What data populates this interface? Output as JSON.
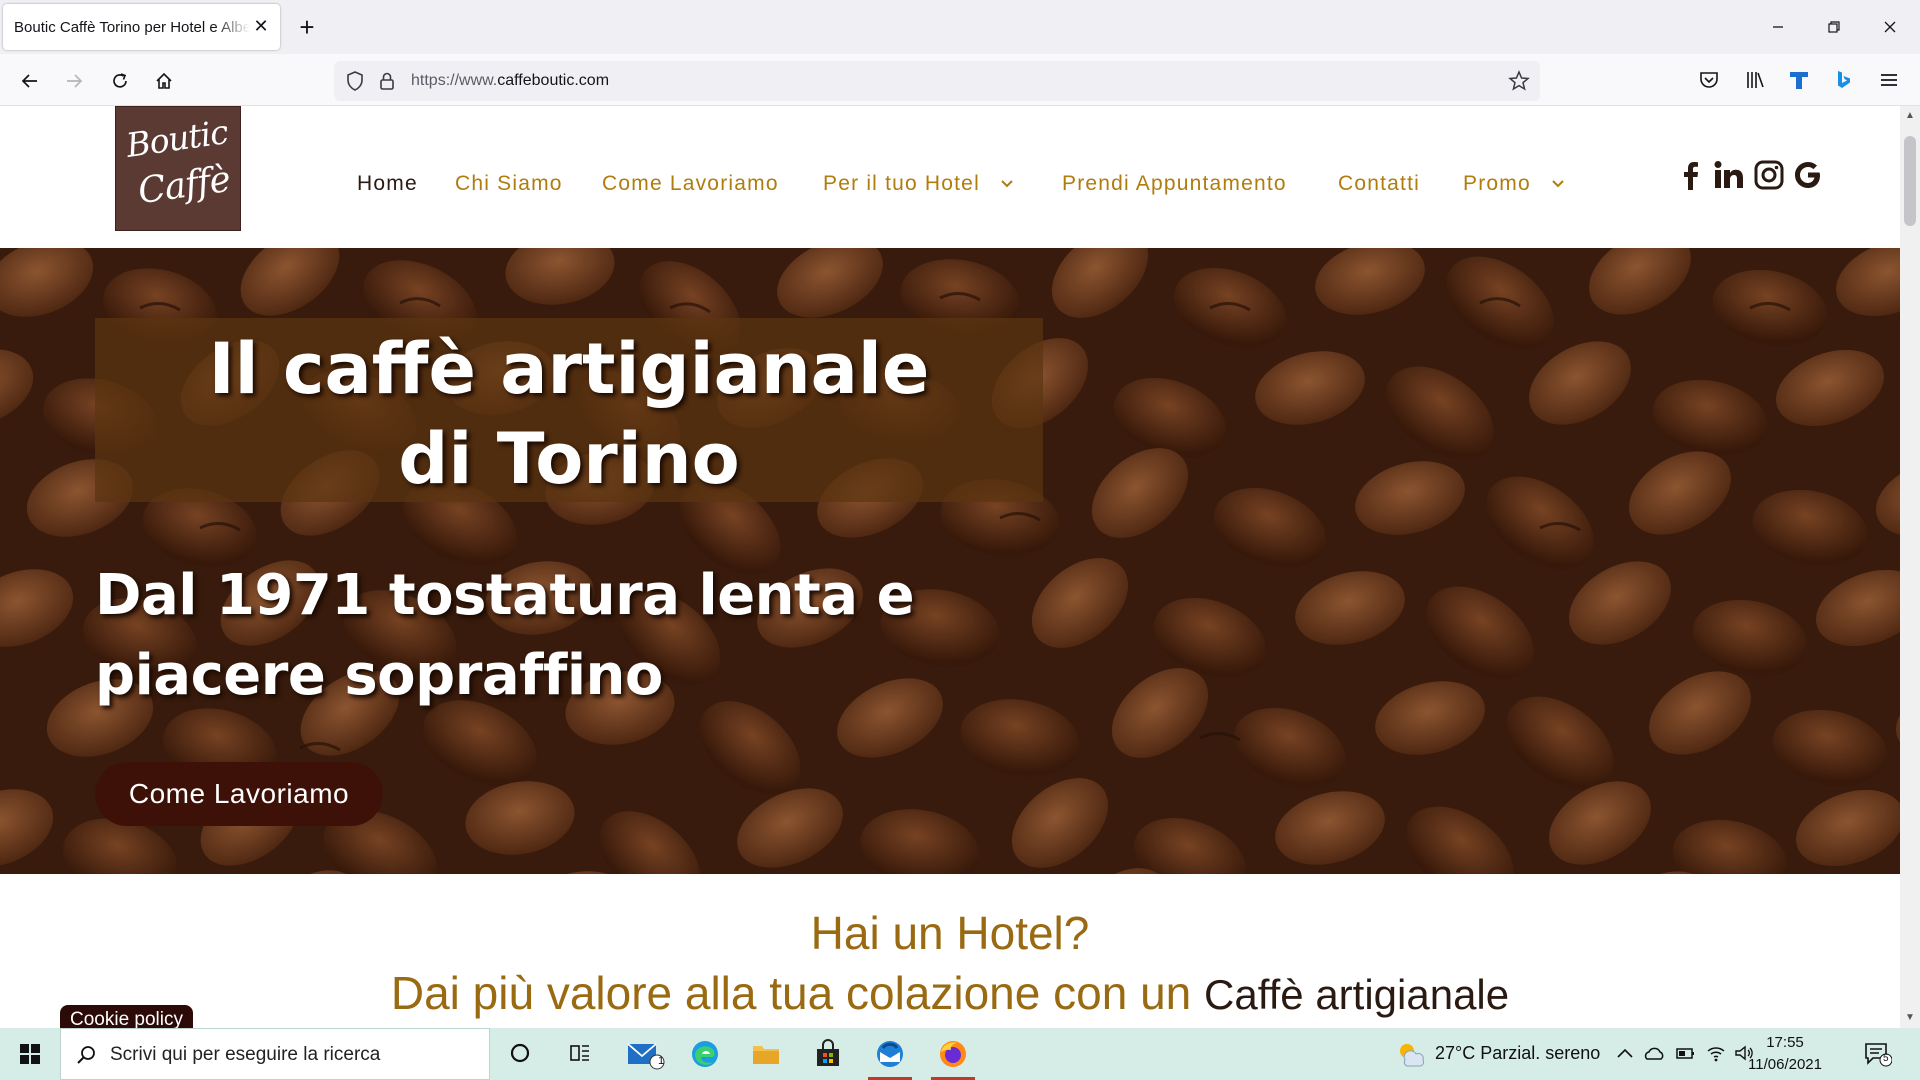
{
  "browser": {
    "tab_title": "Boutic Caffè Torino per Hotel e Alberghi",
    "url_prefix": "https://www.",
    "url_domain": "caffeboutic.com"
  },
  "site": {
    "logo_line1": "Boutic",
    "logo_line2": "Caffè",
    "menu": [
      {
        "label": "Home",
        "active": true
      },
      {
        "label": "Chi Siamo"
      },
      {
        "label": "Come Lavoriamo"
      },
      {
        "label": "Per il tuo Hotel",
        "dropdown": true
      },
      {
        "label": "Prendi Appuntamento"
      },
      {
        "label": "Contatti"
      },
      {
        "label": "Promo",
        "dropdown": true
      }
    ],
    "social": [
      "facebook-icon",
      "linkedin-icon",
      "instagram-icon",
      "google-icon"
    ],
    "brand_color": "#b07c0e",
    "dark_color": "#2a1a12"
  },
  "hero": {
    "title_line1": "Il caffè artigianale",
    "title_line2": "di Torino",
    "subtitle_line1": "Dal 1971 tostatura lenta e",
    "subtitle_line2": "piacere sopraffino",
    "button_label": "Come Lavoriamo"
  },
  "section": {
    "title": "Hai un Hotel?",
    "subtitle": "Dai più valore alla tua colazione con un",
    "subtitle_emphasis": "Caffè artigianale"
  },
  "cookie_label": "Cookie policy",
  "taskbar": {
    "search_placeholder": "Scrivi qui per eseguire la ricerca",
    "mail_badge": "1",
    "weather": "27°C  Parzial. sereno",
    "time": "17:55",
    "date": "11/06/2021",
    "notifications": "5"
  }
}
